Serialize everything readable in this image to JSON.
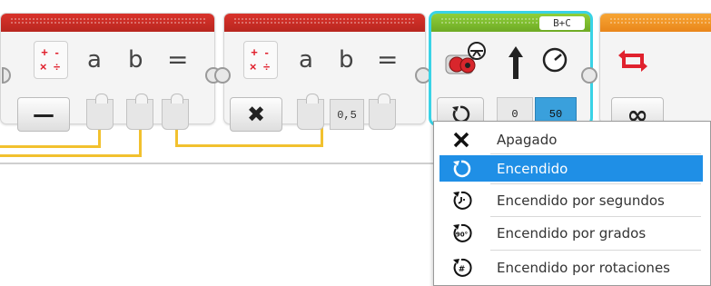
{
  "math_block_1": {
    "icon": "math-icon",
    "input_a": "a",
    "input_b": "b",
    "equals": "=",
    "mode": "subtract"
  },
  "math_block_2": {
    "icon": "math-icon",
    "input_a": "a",
    "input_b": "b",
    "equals": "=",
    "mode": "multiply",
    "b_value": "0,5"
  },
  "motor_block": {
    "ports": "B+C",
    "mode": "on",
    "steering": "0",
    "power": "50"
  },
  "loop_block": {
    "mode": "infinite"
  },
  "math_symbols": {
    "plus": "+",
    "minus": "-",
    "times": "×",
    "divide": "÷"
  },
  "mode_glyphs": {
    "subtract": "—",
    "multiply": "✖",
    "infinite": "∞"
  },
  "dropdown": {
    "items": [
      {
        "label": "Apagado",
        "icon": "off-x-icon",
        "selected": false
      },
      {
        "label": "Encendido",
        "icon": "on-icon",
        "selected": true
      },
      {
        "label": "Encendido por segundos",
        "icon": "on-seconds-icon",
        "selected": false
      },
      {
        "label": "Encendido por grados",
        "icon": "on-degrees-icon",
        "selected": false
      },
      {
        "label": "Encendido por rotaciones",
        "icon": "on-rotations-icon",
        "selected": false
      }
    ],
    "icon_labels": {
      "degrees": "90°",
      "rotations": "#"
    }
  },
  "colors": {
    "accent": "#1f8fe6",
    "wire": "#f2c12e",
    "math_header": "#c8281f",
    "motor_header": "#7dbd2f",
    "loop_header": "#f0961f",
    "selection_outline": "#39d3e6"
  }
}
